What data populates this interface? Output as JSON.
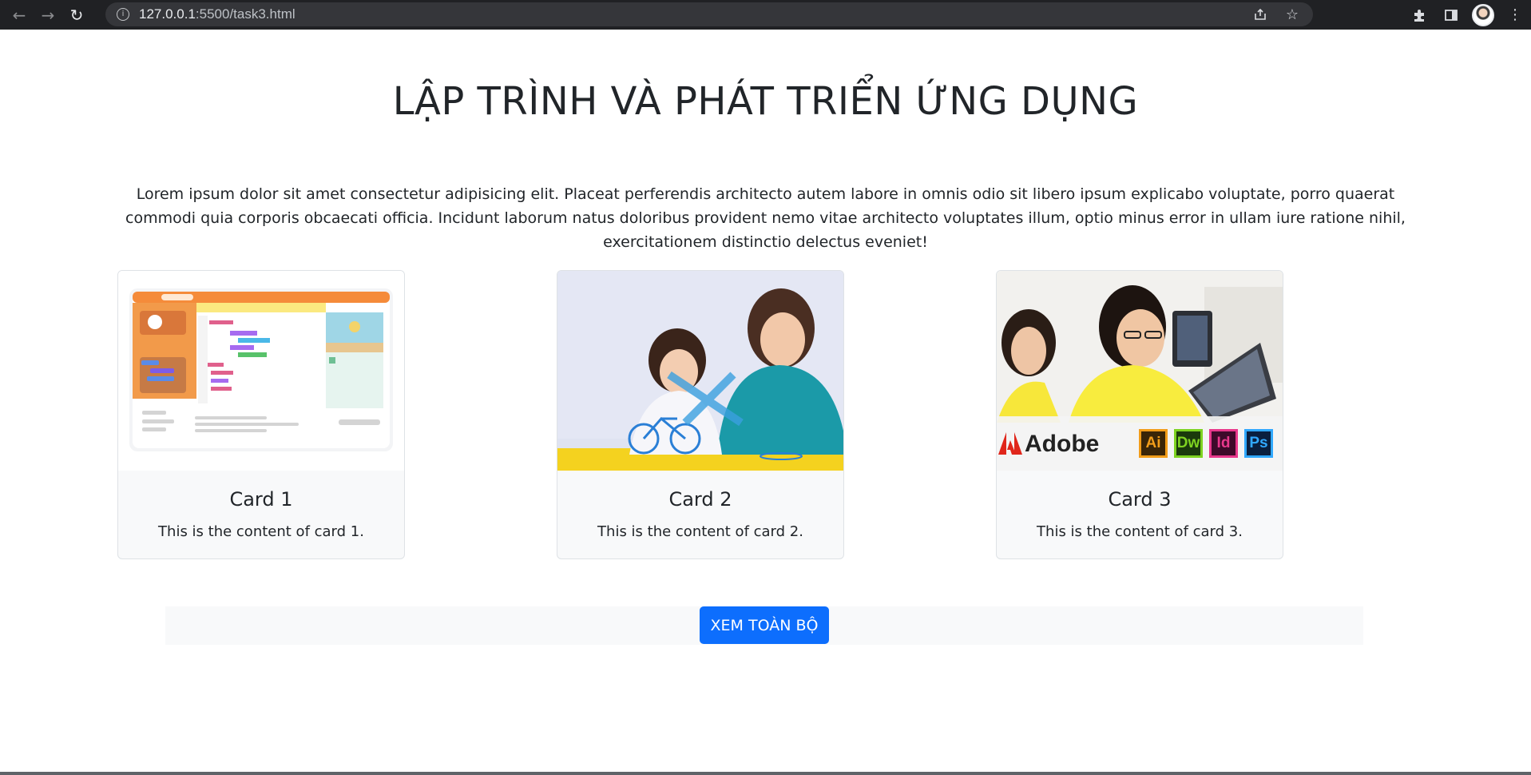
{
  "browser": {
    "url_host": "127.0.0.1",
    "url_rest": ":5500/task3.html",
    "icons": {
      "back": "arrow-left-icon",
      "forward": "arrow-right-icon",
      "reload": "reload-icon",
      "info": "info-icon",
      "share": "share-icon",
      "bookmark": "star-icon",
      "extensions": "puzzle-icon",
      "sidepanel": "side-panel-icon",
      "menu": "kebab-menu-icon"
    }
  },
  "page": {
    "title": "LẬP TRÌNH VÀ PHÁT TRIỂN ỨNG DỤNG",
    "intro": "Lorem ipsum dolor sit amet consectetur adipisicing elit. Placeat perferendis architecto autem labore in omnis odio sit libero ipsum explicabo voluptate, porro quaerat commodi quia corporis obcaecati officia. Incidunt laborum natus doloribus provident nemo vitae architecto voluptates illum, optio minus error in ullam iure ratione nihil, exercitationem distinctio delectus eveniet!",
    "cards": [
      {
        "title": "Card 1",
        "text": "This is the content of card 1."
      },
      {
        "title": "Card 2",
        "text": "This is the content of card 2."
      },
      {
        "title": "Card 3",
        "text": "This is the content of card 3.",
        "image_banner": "Adobe",
        "app_badges": [
          "Ai",
          "Dw",
          "Id",
          "Ps"
        ]
      }
    ],
    "view_all_label": "XEM TOÀN BỘ"
  },
  "colors": {
    "primary": "#0d6efd",
    "card_bg": "#f8f9fa",
    "text": "#212529",
    "chrome_bg": "#202124"
  }
}
